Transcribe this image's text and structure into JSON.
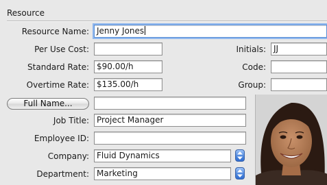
{
  "section": {
    "title": "Resource"
  },
  "fields": {
    "resource_name": {
      "label": "Resource Name:",
      "value": "Jenny Jones"
    },
    "per_use_cost": {
      "label": "Per Use Cost:",
      "value": ""
    },
    "standard_rate": {
      "label": "Standard Rate:",
      "value": "$90.00/h"
    },
    "overtime_rate": {
      "label": "Overtime Rate:",
      "value": "$135.00/h"
    },
    "full_name": {
      "button_label": "Full Name...",
      "value": ""
    },
    "job_title": {
      "label": "Job Title:",
      "value": "Project Manager"
    },
    "employee_id": {
      "label": "Employee ID:",
      "value": ""
    },
    "company": {
      "label": "Company:",
      "value": "Fluid Dynamics"
    },
    "department": {
      "label": "Department:",
      "value": "Marketing"
    },
    "initials": {
      "label": "Initials:",
      "value": "JJ"
    },
    "code": {
      "label": "Code:",
      "value": ""
    },
    "group": {
      "label": "Group:",
      "value": ""
    }
  },
  "icons": {
    "stepper": "up-down-stepper-icon"
  },
  "colors": {
    "focus_ring": "#8fb7ee",
    "stepper_blue": "#4f88dd"
  }
}
